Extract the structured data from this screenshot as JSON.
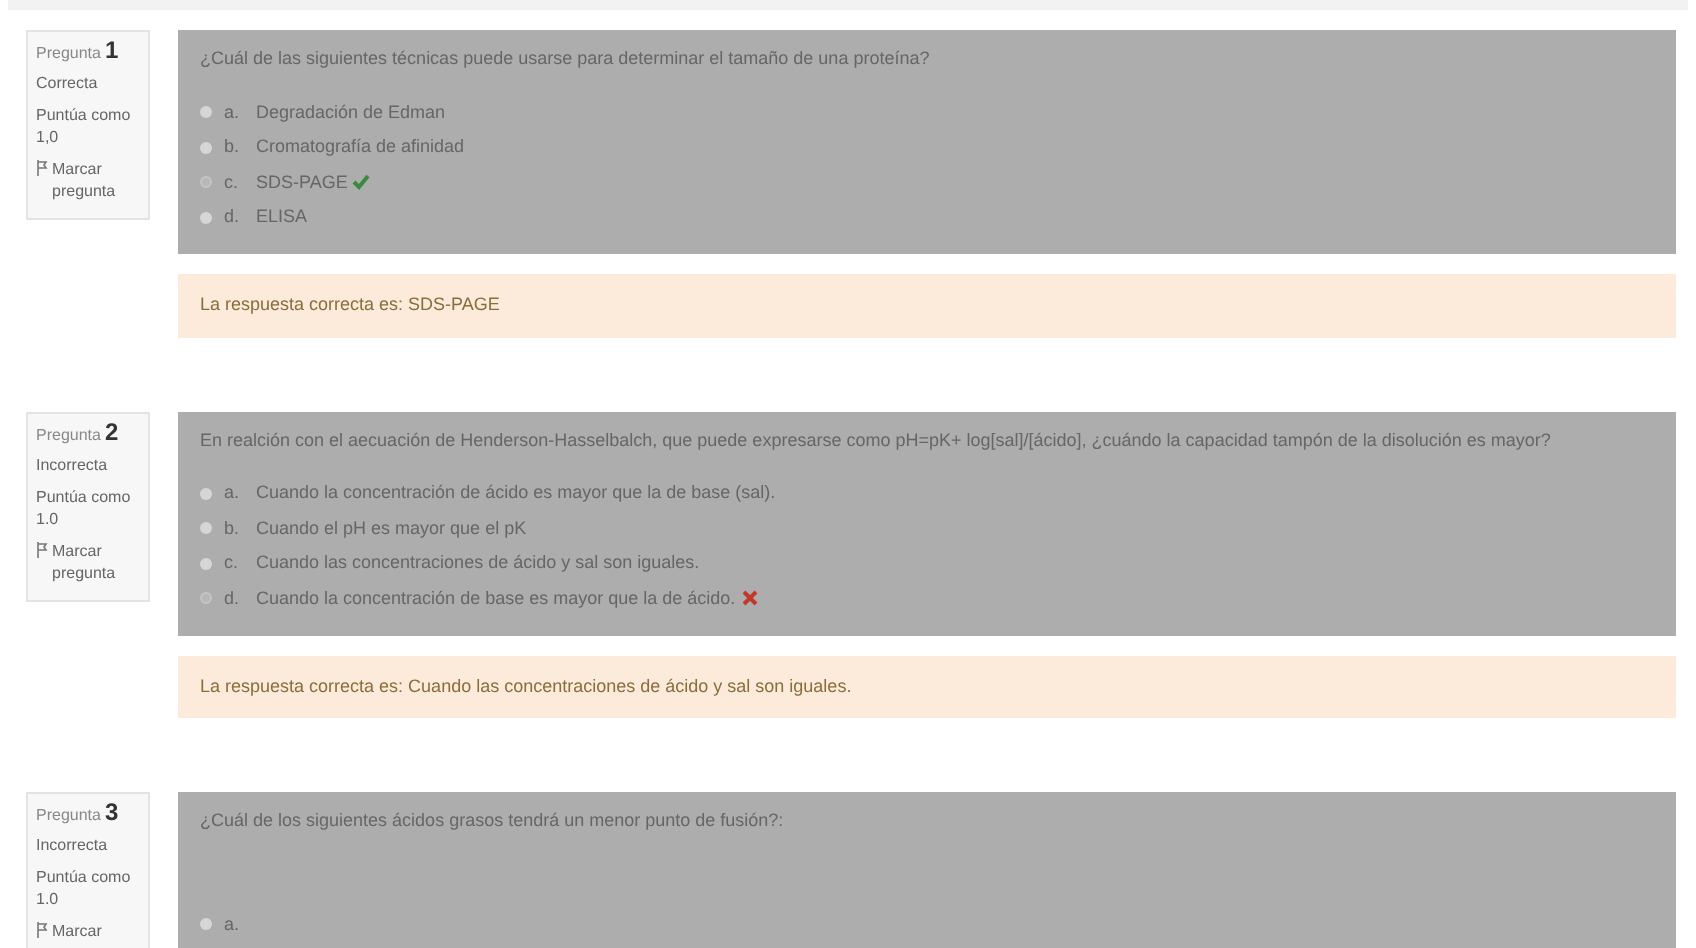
{
  "questions": [
    {
      "label": "Pregunta",
      "number": "1",
      "status": "Correcta",
      "score_label": "Puntúa como",
      "score": "1,0",
      "flag": "Marcar pregunta",
      "text": "¿Cuál de las siguientes técnicas puede usarse para determinar el tamaño de una proteína?",
      "options": [
        {
          "letter": "a.",
          "text": "Degradación de Edman",
          "selected": false,
          "kind": "plain"
        },
        {
          "letter": "b.",
          "text": "Cromatografía de afinidad",
          "selected": false,
          "kind": "plain"
        },
        {
          "letter": "c.",
          "text": "SDS-PAGE",
          "selected": true,
          "kind": "correct"
        },
        {
          "letter": "d.",
          "text": "ELISA",
          "selected": false,
          "kind": "plain"
        }
      ],
      "feedback": "La respuesta correcta es: SDS-PAGE"
    },
    {
      "label": "Pregunta",
      "number": "2",
      "status": "Incorrecta",
      "score_label": "Puntúa como",
      "score": "1.0",
      "flag": "Marcar pregunta",
      "text": "En realción con el aecuación de Henderson-Hasselbalch, que puede expresarse como pH=pK+ log[sal]/[ácido], ¿cuándo la capacidad tampón de la disolución es mayor?",
      "options": [
        {
          "letter": "a.",
          "text": "Cuando la concentración de ácido es mayor que la de base (sal).",
          "selected": false,
          "kind": "plain"
        },
        {
          "letter": "b.",
          "text": "Cuando el pH es mayor que el pK",
          "selected": false,
          "kind": "plain"
        },
        {
          "letter": "c.",
          "text": "Cuando las concentraciones de ácido y sal son iguales.",
          "selected": false,
          "kind": "plain"
        },
        {
          "letter": "d.",
          "text": "Cuando la concentración de base es mayor que la de ácido.",
          "selected": true,
          "kind": "incorrect"
        }
      ],
      "feedback": "La respuesta correcta es: Cuando las concentraciones de ácido y sal son iguales."
    },
    {
      "label": "Pregunta",
      "number": "3",
      "status": "Incorrecta",
      "score_label": "Puntúa como",
      "score": "1.0",
      "flag": "Marcar",
      "text": "¿Cuál de los siguientes ácidos grasos tendrá un menor punto de fusión?:",
      "options": [
        {
          "letter": "a.",
          "selected": false,
          "kind": "plain"
        }
      ]
    }
  ]
}
